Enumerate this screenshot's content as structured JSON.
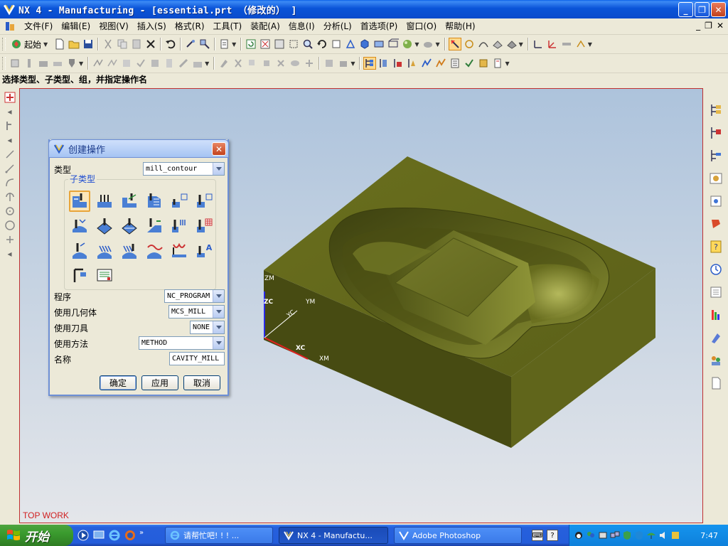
{
  "window": {
    "title": "NX 4 - Manufacturing - [essential.prt （修改的） ]",
    "minimize": "_",
    "restore": "❐",
    "close": "✕"
  },
  "menubar": {
    "items": [
      "文件(F)",
      "编辑(E)",
      "视图(V)",
      "插入(S)",
      "格式(R)",
      "工具(T)",
      "装配(A)",
      "信息(I)",
      "分析(L)",
      "首选项(P)",
      "窗口(O)",
      "帮助(H)"
    ],
    "mdi_min": "_",
    "mdi_restore": "❐",
    "mdi_close": "✕"
  },
  "toolbar": {
    "start_label": "起始"
  },
  "cue_line": "选择类型、子类型、组，并指定操作名",
  "graphics": {
    "view_label": "TOP WORK",
    "axes": {
      "zm": "ZM",
      "zc": "ZC",
      "ym": "YM",
      "yc": "YC",
      "xc": "XC",
      "xm": "XM"
    },
    "part_color": "#5d611a"
  },
  "dialog": {
    "title": "创建操作",
    "close": "✕",
    "type_label": "类型",
    "type_value": "mill_contour",
    "subtype_label": "子类型",
    "subtype_icons": [
      "cavity-mill-icon",
      "plunge-milling-icon",
      "corner-rough-icon",
      "zlevel-profile-icon",
      "zlevel-corner-icon",
      "fixed-contour-icon",
      "contour-area-icon",
      "contour-surface-area-icon",
      "streamline-icon",
      "contour-area-dir-steep-icon",
      "flowcut-single-icon",
      "flowcut-multiple-icon",
      "flowcut-ref-tool-icon",
      "flowcut-smooth-icon",
      "solid-profile-3d-icon",
      "profile-3d-icon",
      "contour-text-icon",
      "mill-user-icon",
      "mill-control-icon"
    ],
    "program_label": "程序",
    "program_value": "NC_PROGRAM",
    "geometry_label": "使用几何体",
    "geometry_value": "MCS_MILL",
    "tool_label": "使用刀具",
    "tool_value": "NONE",
    "method_label": "使用方法",
    "method_value": "METHOD",
    "name_label": "名称",
    "name_value": "CAVITY_MILL",
    "ok": "确定",
    "apply": "应用",
    "cancel": "取消"
  },
  "taskbar": {
    "start": "开始",
    "tasks": [
      {
        "label": "请帮忙吧! ! ! ...",
        "icon": "ie-icon"
      },
      {
        "label": "NX 4 - Manufactu...",
        "icon": "nx-icon"
      },
      {
        "label": "Adobe Photoshop",
        "icon": "photoshop-icon"
      }
    ],
    "clock": "7:47"
  }
}
